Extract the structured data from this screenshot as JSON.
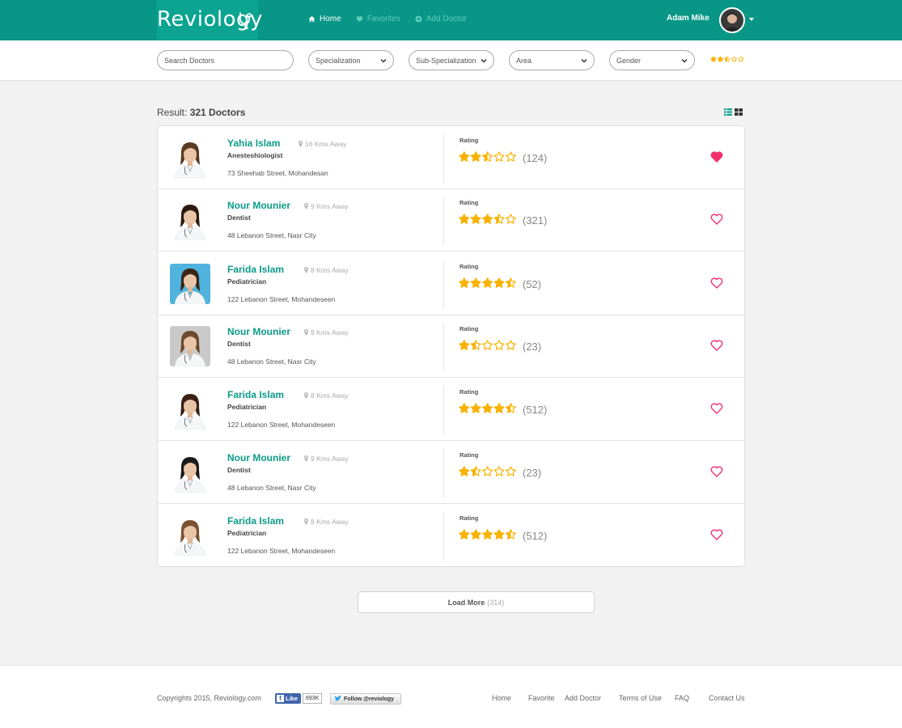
{
  "app": {
    "logo": "Reviology",
    "nav": [
      {
        "label": "Home",
        "icon": "home-icon",
        "active": true
      },
      {
        "label": "Favorites",
        "icon": "heart-icon",
        "active": false
      },
      {
        "label": "Add Doctor",
        "icon": "plus-circle-icon",
        "active": false
      }
    ],
    "user_name": "Adam Mike"
  },
  "filters": {
    "search_placeholder": "Search Doctors",
    "specialization": "Specialization",
    "sub_specialization": "Sub-Specialization",
    "area": "Area",
    "gender": "Gender",
    "rating": 2.5
  },
  "results": {
    "label": "Result:",
    "count_text": "321 Doctors",
    "rating_label": "Rating",
    "doctors": [
      {
        "name": "Yahia Islam",
        "distance": "16 Kms Away",
        "specialty": "Anesteshiologist",
        "address": "73 Sheehab Street, Mohandesan",
        "rating": 2.5,
        "reviews": "(124)",
        "favorite": true
      },
      {
        "name": "Nour Mounier",
        "distance": "9 Kms Away",
        "specialty": "Dentist",
        "address": "48 Lebanon Street, Nasr City",
        "rating": 3.5,
        "reviews": "(321)",
        "favorite": false
      },
      {
        "name": "Farida Islam",
        "distance": "8 Kms Away",
        "specialty": "Pediatrician",
        "address": "122 Lebanon Street, Mohandeseen",
        "rating": 4.5,
        "reviews": "(52)",
        "favorite": false
      },
      {
        "name": "Nour Mounier",
        "distance": "9 Kms Away",
        "specialty": "Dentist",
        "address": "48 Lebanon Street, Nasr City",
        "rating": 1.5,
        "reviews": "(23)",
        "favorite": false
      },
      {
        "name": "Farida Islam",
        "distance": "8 Kms Away",
        "specialty": "Pediatrician",
        "address": "122 Lebanon Street, Mohandeseen",
        "rating": 4.5,
        "reviews": "(512)",
        "favorite": false
      },
      {
        "name": "Nour Mounier",
        "distance": "9 Kms Away",
        "specialty": "Dentist",
        "address": "48 Lebanon Street, Nasr City",
        "rating": 1.5,
        "reviews": "(23)",
        "favorite": false
      },
      {
        "name": "Farida Islam",
        "distance": "8 Kms Away",
        "specialty": "Pediatrician",
        "address": "122 Lebanon Street, Mohandeseen",
        "rating": 4.5,
        "reviews": "(512)",
        "favorite": false
      }
    ],
    "load_more": "Load More",
    "load_more_count": "(314)"
  },
  "footer": {
    "copyright": "Copyrights 2015, Reviology.com",
    "fb_like": "Like",
    "fb_count": "693K",
    "twitter": "Follow @reviology",
    "links": [
      "Home",
      "Favorite",
      "Add Doctor",
      "Terms of Use",
      "FAQ",
      "Contact Us"
    ]
  },
  "colors": {
    "brand": "#089686",
    "brand_light": "#0ba491",
    "name_teal": "#0c9b89",
    "star": "#f9b200",
    "heart": "#f0306e"
  }
}
